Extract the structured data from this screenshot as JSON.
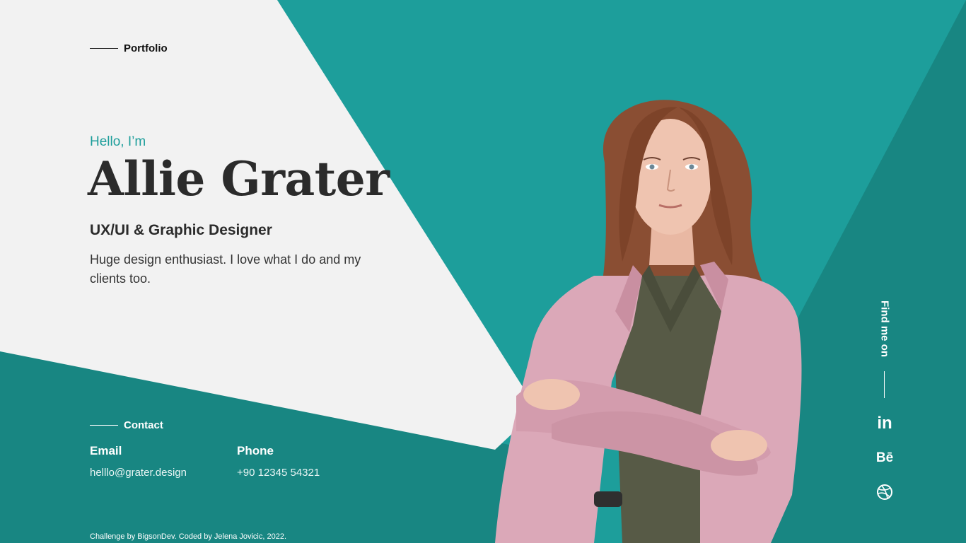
{
  "colors": {
    "teal": "#1d9e9b",
    "teal_dark": "#188682",
    "light_bg": "#f2f2f2",
    "text_dark": "#2b2b2b",
    "white": "#ffffff"
  },
  "header": {
    "portfolio_label": "Portfolio"
  },
  "hero": {
    "greeting": "Hello, I’m",
    "name": "Allie Grater",
    "role": "UX/UI & Graphic Designer",
    "description": "Huge design enthusiast. I love what I do and my clients too."
  },
  "contact": {
    "section_label": "Contact",
    "email_label": "Email",
    "email_value": "helllo@grater.design",
    "phone_label": "Phone",
    "phone_value": "+90 12345 54321"
  },
  "social": {
    "find_me_label": "Find me on",
    "icons": [
      "linkedin-icon",
      "behance-icon",
      "dribbble-icon"
    ],
    "linkedin_glyph": "in",
    "behance_glyph": "Bē"
  },
  "footer": {
    "credit": "Challenge by BigsonDev. Coded by Jelena Jovicic, 2022."
  }
}
